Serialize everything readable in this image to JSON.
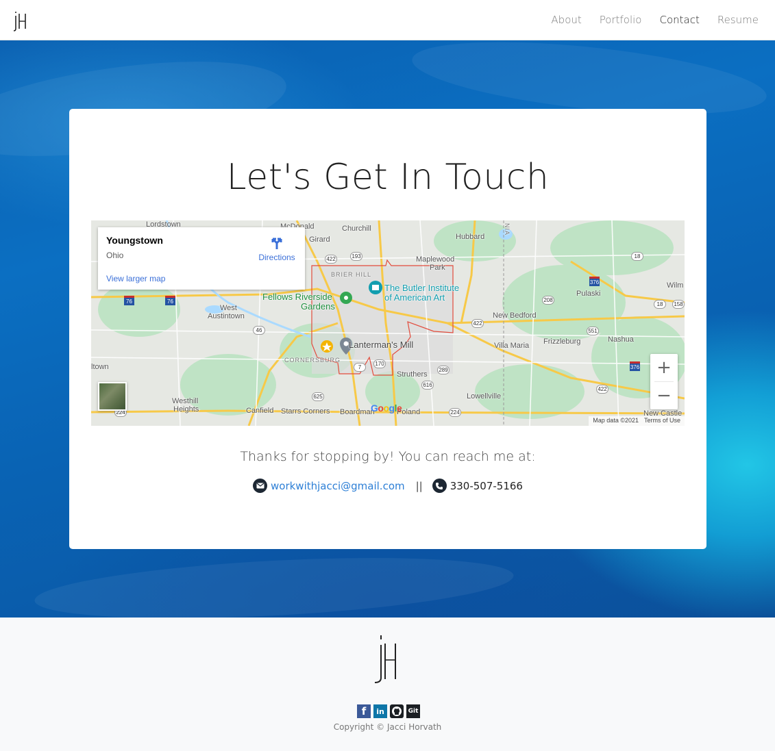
{
  "nav": {
    "items": [
      {
        "label": "About"
      },
      {
        "label": "Portfolio"
      },
      {
        "label": "Contact",
        "active": true
      },
      {
        "label": "Resume"
      }
    ]
  },
  "hero": {
    "title": "Let's Get In Touch"
  },
  "map": {
    "place_name": "Youngstown",
    "place_region": "Ohio",
    "directions_label": "Directions",
    "larger_map_label": "View larger map",
    "zoom_in_label": "+",
    "zoom_out_label": "−",
    "google_label": "Google",
    "attribution": "Map data ©2021",
    "terms": "Terms of Use",
    "labels": {
      "lordstown": "Lordstown",
      "mcdonald": "McDonald",
      "churchill": "Churchill",
      "girard": "Girard",
      "hubbard": "Hubbard",
      "maplewood": "Maplewood",
      "park": "Park",
      "brier_hill": "BRIER HILL",
      "butler1": "The Butler Institute",
      "butler2": "of American Art",
      "fellows1": "Fellows Riverside",
      "fellows2": "Gardens",
      "west_austintown1": "West",
      "west_austintown2": "Austintown",
      "lanterman": "Lanterman's Mill",
      "new_bedford": "New Bedford",
      "villa_maria": "Villa Maria",
      "frizzleburg": "Frizzleburg",
      "nashua": "Nashua",
      "pulaski": "Pulaski",
      "wilm": "Wilm",
      "cornersburg": "CORNERSBURG",
      "struthers": "Struthers",
      "itown": "ltown",
      "westhill1": "Westhill",
      "westhill2": "Heights",
      "canfield": "Canfield",
      "starrs": "Starrs Corners",
      "boardman": "Boardman",
      "poland": "Poland",
      "lowellville": "Lowellville",
      "new_castle": "New Castle",
      "nia": "NIA"
    },
    "shields": {
      "s422a": "422",
      "s193": "193",
      "s18": "18",
      "s376a": "376",
      "s208": "208",
      "s158": "158",
      "s18b": "18",
      "s422b": "422",
      "s551": "551",
      "s46": "46",
      "s170": "170",
      "s7": "7",
      "s289": "289",
      "s616": "616",
      "s625": "625",
      "s224a": "224",
      "s224b": "224",
      "s376b": "376",
      "s422c": "422",
      "s76a": "76",
      "s76b": "76"
    }
  },
  "contact": {
    "intro": "Thanks for stopping by! You can reach me at:",
    "email": "workwithjacci@gmail.com",
    "divider": "||",
    "phone": "330-507-5166"
  },
  "footer": {
    "socials": [
      {
        "name": "facebook",
        "label": "f",
        "color": "#3b5998"
      },
      {
        "name": "linkedin",
        "label": "in",
        "color": "#0e76a8"
      },
      {
        "name": "github",
        "label": "",
        "color": "#1b1f23"
      },
      {
        "name": "git",
        "label": "Git",
        "color": "#1b1f23"
      }
    ],
    "copyright": "Copyright © Jacci Horvath"
  },
  "colors": {
    "link": "#2d7fd6",
    "map_link": "#3a6fd8",
    "card_bg": "#ffffff",
    "footer_bg": "#f8f9fa"
  }
}
